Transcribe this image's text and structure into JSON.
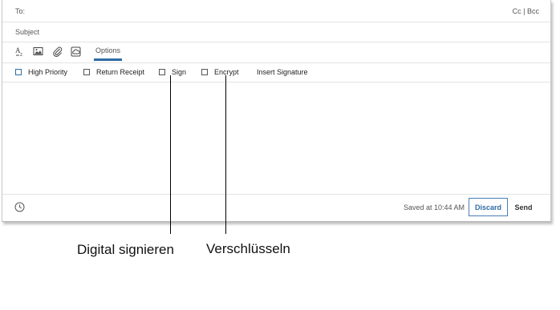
{
  "header": {
    "to_label": "To:",
    "cc_bcc_label": "Cc | Bcc",
    "subject_label": "Subject"
  },
  "toolbar": {
    "icons": [
      "text-format-icon",
      "image-icon",
      "attachment-icon",
      "cloud-icon"
    ],
    "options_tab": "Options",
    "accent_color": "#2e6ca4"
  },
  "options": {
    "high_priority": "High Priority",
    "return_receipt": "Return Receipt",
    "sign": "Sign",
    "encrypt": "Encrypt",
    "insert_signature": "Insert Signature"
  },
  "footer": {
    "clock_icon": "clock-icon",
    "saved_status": "Saved at 10:44 AM",
    "discard_label": "Discard",
    "send_label": "Send"
  },
  "callouts": {
    "sign_caption": "Digital signieren",
    "encrypt_caption": "Verschlüsseln"
  }
}
